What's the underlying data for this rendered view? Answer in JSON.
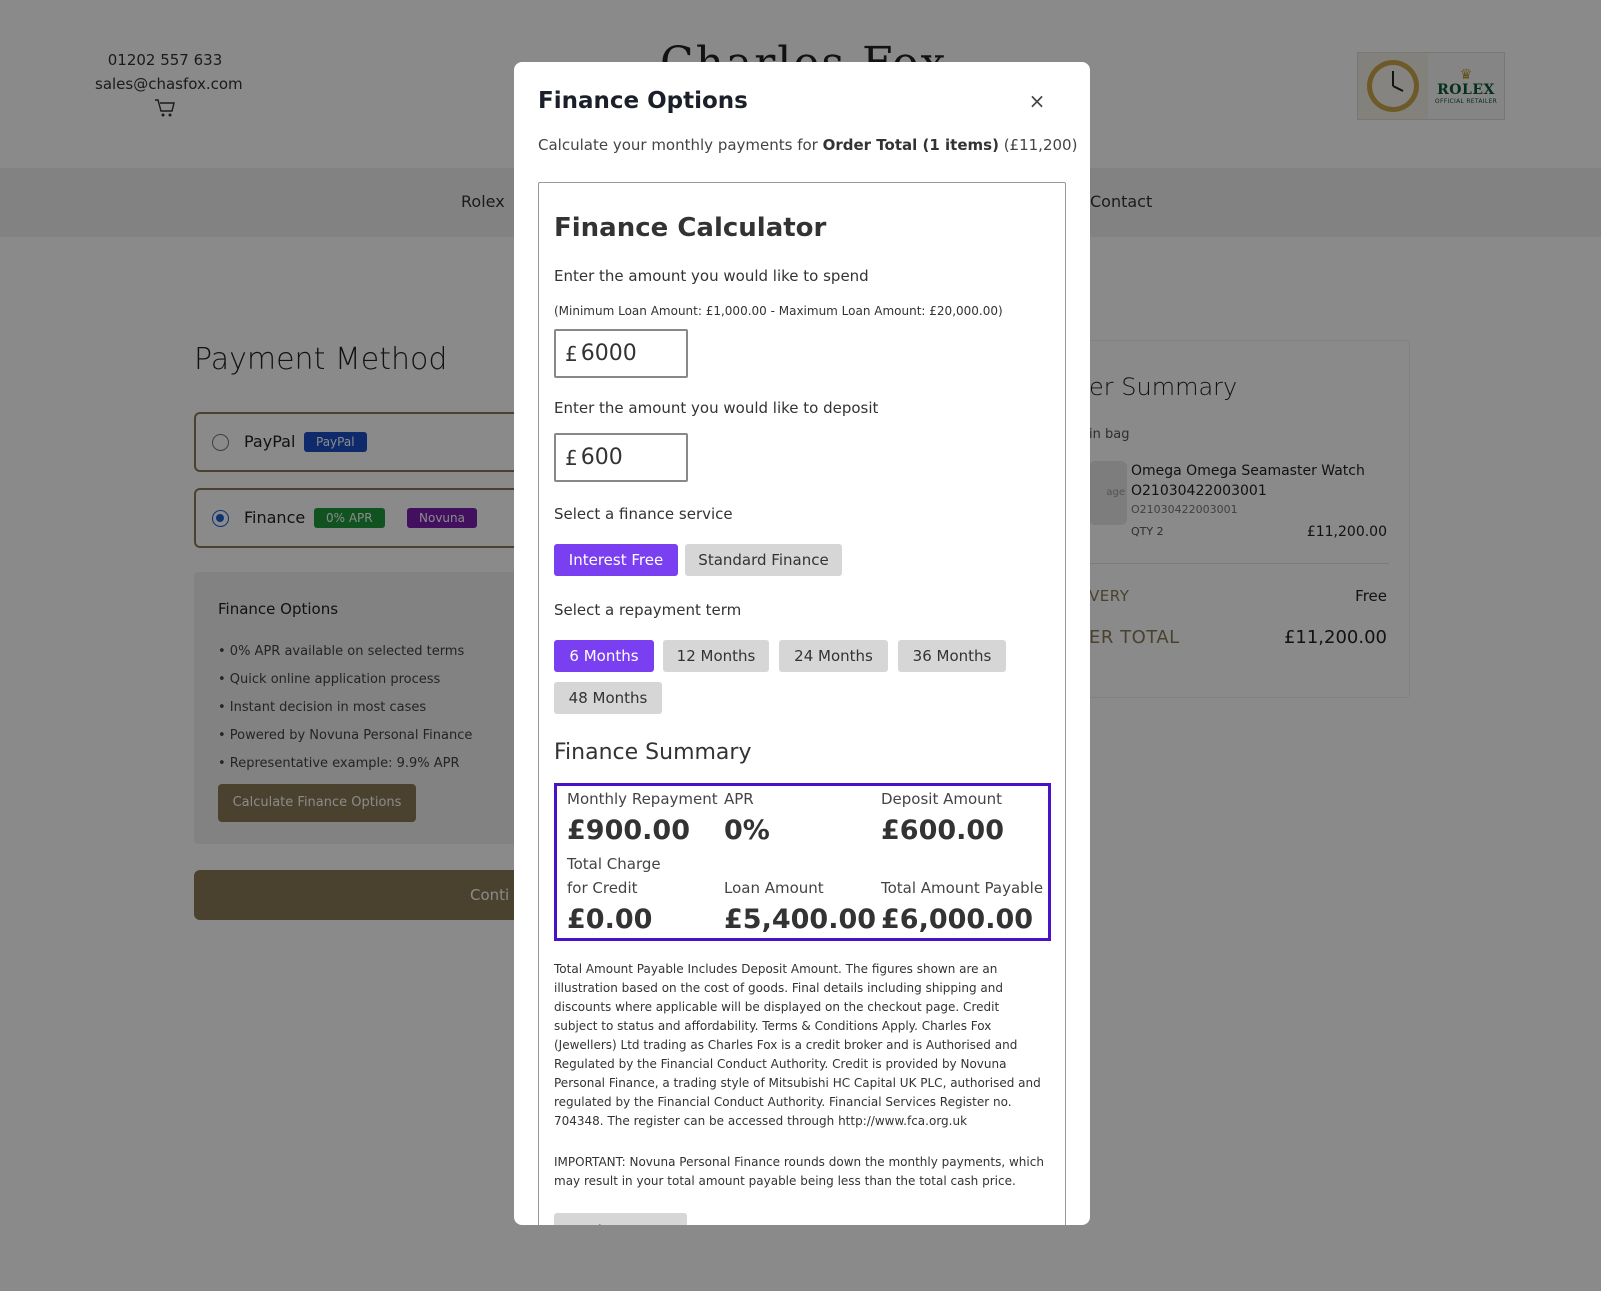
{
  "header": {
    "phone": "01202 557 633",
    "email": "sales@chasfox.com",
    "logo_text": "Charles Fox",
    "rolex_brand": "ROLEX",
    "rolex_sub": "OFFICIAL RETAILER"
  },
  "nav": {
    "items": [
      "Rolex",
      "Contact"
    ]
  },
  "payment": {
    "title": "Payment Method",
    "paypal_label": "PayPal",
    "paypal_badge": "PayPal",
    "finance_label": "Finance",
    "finance_badge_apr": "0% APR",
    "finance_badge_novuna": "Novuna",
    "selected": "Finance"
  },
  "finance_options_box": {
    "title": "Finance Options",
    "bullets": [
      "• 0% APR available on selected terms",
      "• Quick online application process",
      "• Instant decision in most cases",
      "• Powered by Novuna Personal Finance",
      "• Representative example: 9.9% APR"
    ],
    "button": "Calculate Finance Options",
    "continue": "Conti"
  },
  "order_summary": {
    "title": "er Summary",
    "in_bag": "in bag",
    "img_placeholder": "age",
    "product_name": "Omega Omega Seamaster Watch O21030422003001",
    "sku": "O21030422003001",
    "qty": "QTY 2",
    "price": "£11,200.00",
    "delivery_label": "VERY",
    "delivery_value": "Free",
    "total_label": "ER TOTAL",
    "total_value": "£11,200.00"
  },
  "modal": {
    "title": "Finance Options",
    "close": "×",
    "subtitle_prefix": "Calculate your monthly payments for",
    "subtitle_bold": "Order Total (1 items)",
    "subtitle_suffix": "(£11,200)",
    "calculator": {
      "title": "Finance Calculator",
      "spend_label": "Enter the amount you would like to spend",
      "limits_note": "(Minimum Loan Amount: £1,000.00 - Maximum Loan Amount: £20,000.00)",
      "currency": "£",
      "spend_value": "6000",
      "deposit_label": "Enter the amount you would like to deposit",
      "deposit_value": "600",
      "service_label": "Select a finance service",
      "services": [
        "Interest Free",
        "Standard Finance"
      ],
      "selected_service": "Interest Free",
      "term_label": "Select a repayment term",
      "terms": [
        "6 Months",
        "12 Months",
        "24 Months",
        "36 Months",
        "48 Months"
      ],
      "selected_term": "6 Months"
    },
    "summary": {
      "title": "Finance Summary",
      "monthly_label": "Monthly Repayment",
      "monthly_value": "£900.00",
      "apr_label": "APR",
      "apr_value": "0%",
      "deposit_label": "Deposit Amount",
      "deposit_value": "£600.00",
      "charge_label_1": "Total Charge",
      "charge_label_2": "for Credit",
      "charge_value": "£0.00",
      "loan_label": "Loan Amount",
      "loan_value": "£5,400.00",
      "payable_label": "Total Amount Payable",
      "payable_value": "£6,000.00"
    },
    "disclaimer": "Total Amount Payable Includes Deposit Amount. The figures shown are an illustration based on the cost of goods. Final details including shipping and discounts where applicable will be displayed on the checkout page. Credit subject to status and affordability. Terms & Conditions Apply. Charles Fox (Jewellers) Ltd trading as Charles Fox is a credit broker and is Authorised and Regulated by the Financial Conduct Authority. Credit is provided by Novuna Personal Finance, a trading style of Mitsubishi HC Capital UK PLC, authorised and regulated by the Financial Conduct Authority. Financial Services Register no. 704348. The register can be accessed through http://www.fca.org.uk",
    "important": "IMPORTANT: Novuna Personal Finance rounds down the monthly payments, which may result in your total amount payable being less than the total cash price.",
    "back_button": "Back to Finance"
  },
  "colors": {
    "accent_purple": "#7b3ff2",
    "summary_border": "#4a12c7",
    "brand_gold": "#8a7a55",
    "badge_green": "#1f9a3c",
    "badge_purple": "#7a1fb0",
    "badge_blue": "#1a4fc4"
  }
}
